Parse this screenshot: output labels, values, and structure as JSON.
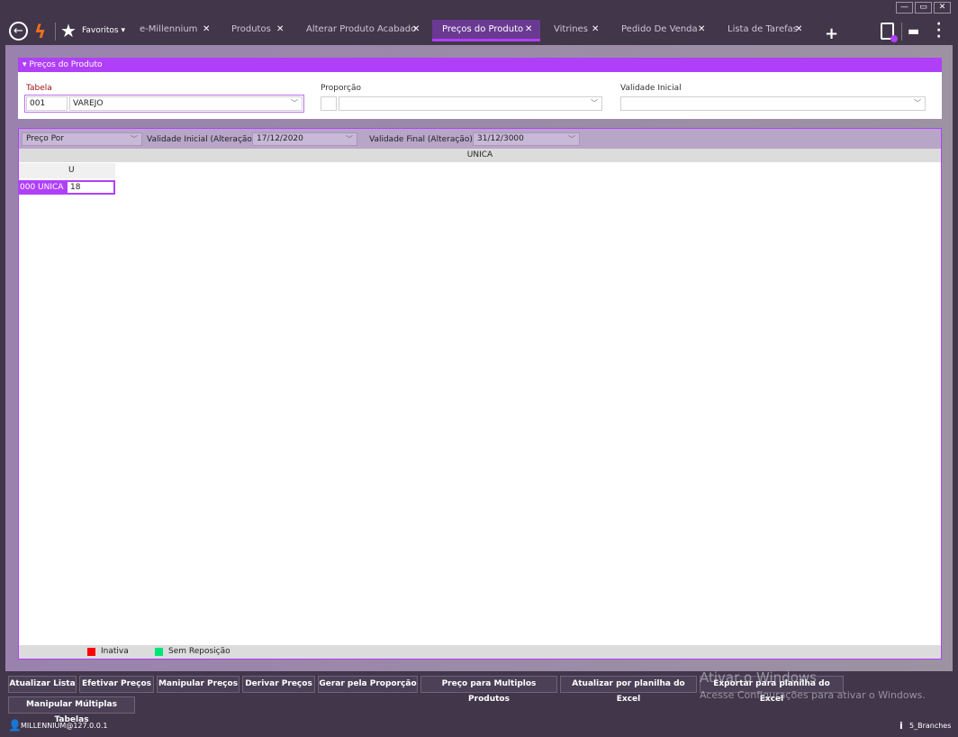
{
  "window": {
    "minimize": "—",
    "maximize": "▭",
    "close": "✕"
  },
  "nav": {
    "favorites": "Favoritos"
  },
  "tabs": [
    {
      "label": "e-Millennium"
    },
    {
      "label": "Produtos"
    },
    {
      "label": "Alterar Produto Acabado"
    },
    {
      "label": "Preços do Produto",
      "active": true
    },
    {
      "label": "Vitrines"
    },
    {
      "label": "Pedido De Venda"
    },
    {
      "label": "Lista de Tarefas"
    }
  ],
  "panel": {
    "title": "Preços do Produto",
    "tabela": {
      "label": "Tabela",
      "code": "001",
      "name": "VAREJO"
    },
    "proporcao": {
      "label": "Proporção",
      "value": ""
    },
    "validade_inicial": {
      "label": "Validade Inicial",
      "value": ""
    }
  },
  "filters": {
    "preco_por": "Preço Por",
    "val_ini_label": "Validade Inicial (Alteração)",
    "val_ini": "17/12/2020",
    "val_fin_label": "Validade Final (Alteração)",
    "val_fin": "31/12/3000"
  },
  "grid": {
    "group_header": "UNICA",
    "col_header": "U",
    "row_label": "000 UNICA",
    "cell_value": "18"
  },
  "legend": [
    {
      "label": "Inativa",
      "color": "#ff0000"
    },
    {
      "label": "Sem Reposição",
      "color": "#00e676"
    }
  ],
  "buttons": [
    "Atualizar Lista",
    "Efetivar Preços",
    "Manipular Preços",
    "Derivar Preços",
    "Gerar pela Proporção",
    "Preço para Multiplos Produtos",
    "Atualizar por planilha do Excel",
    "Exportar para planilha do Excel",
    "Manipular Múltiplas Tabelas"
  ],
  "watermark": {
    "title": "Ativar o Windows",
    "text": "Acesse Configurações para ativar o Windows."
  },
  "status": {
    "user": "MILLENNIUM@127.0.0.1",
    "branch": "5_Branches"
  }
}
